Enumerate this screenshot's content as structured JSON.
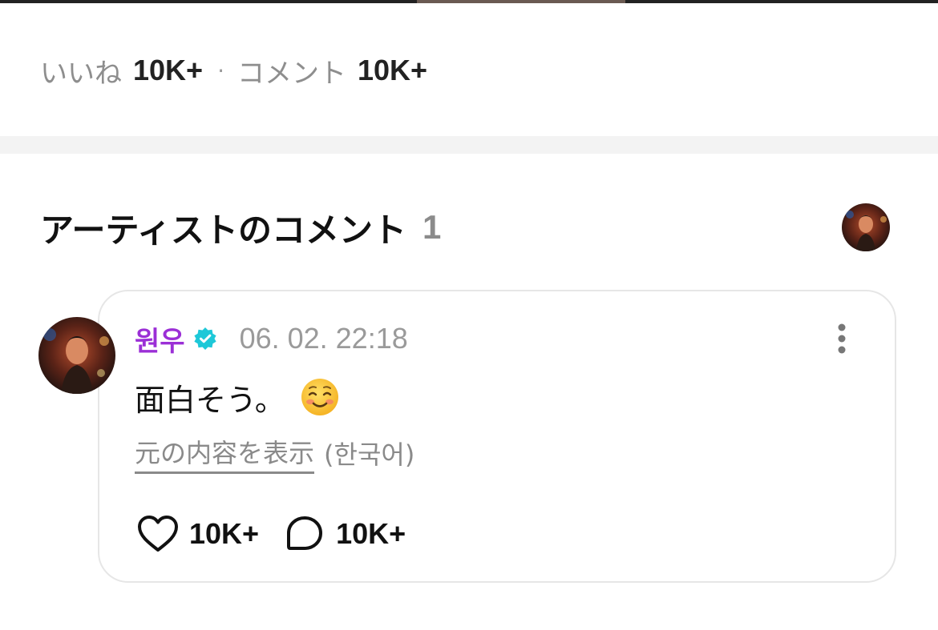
{
  "stats": {
    "likes_label": "いいね",
    "likes_count": "10K+",
    "separator": "·",
    "comments_label": "コメント",
    "comments_count": "10K+"
  },
  "artist_comments": {
    "title": "アーティストのコメント",
    "count": "1"
  },
  "comment": {
    "author": "원우",
    "verified_icon": "verified-badge-icon",
    "timestamp": "06. 02. 22:18",
    "text": "面白そう。",
    "emoji": "smiling-face-icon",
    "translate_link": "元の内容を表示",
    "original_language": "(한국어)",
    "like_icon": "heart-outline-icon",
    "like_count": "10K+",
    "reply_icon": "chat-bubble-outline-icon",
    "reply_count": "10K+"
  },
  "colors": {
    "author": "#9b2fd6",
    "verified": "#1ec8d8",
    "muted": "#8a8a8a",
    "separator_band": "#f3f3f3",
    "card_border": "#e6e6e6"
  }
}
